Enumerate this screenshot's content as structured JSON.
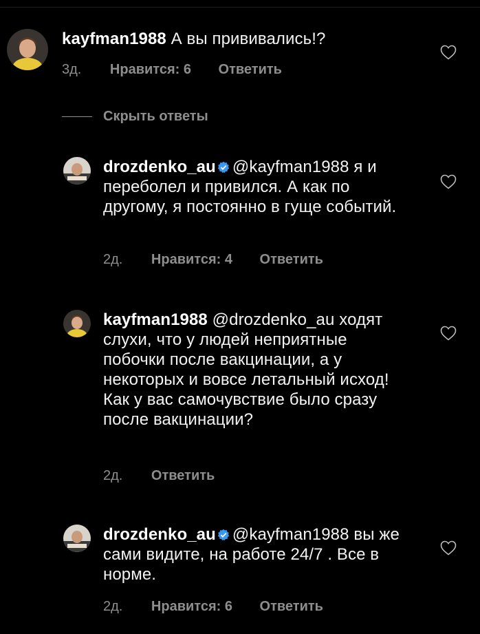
{
  "comments": [
    {
      "username": "kayfman1988",
      "verified": false,
      "mention": "",
      "text": "А вы прививались!?",
      "time": "3д.",
      "likes": "Нравится: 6",
      "reply": "Ответить",
      "avatar": "woman-avatar"
    },
    {
      "username": "drozdenko_au",
      "verified": true,
      "mention": "@kayfman1988",
      "text": "я и переболел и привился. А как по другому, я постоянно в гуще событий.",
      "time": "2д.",
      "likes": "Нравится: 4",
      "reply": "Ответить",
      "avatar": "man-avatar"
    },
    {
      "username": "kayfman1988",
      "verified": false,
      "mention": "@drozdenko_au",
      "text": "ходят слухи, что у людей неприятные побочки после вакцинации, а у некоторых и вовсе летальный исход! Как у вас самочувствие было сразу после вакцинации?",
      "time": "2д.",
      "likes": "",
      "reply": "Ответить",
      "avatar": "woman-avatar"
    },
    {
      "username": "drozdenko_au",
      "verified": true,
      "mention": "@kayfman1988",
      "text": "вы же сами видите, на работе 24/7 . Все в норме.",
      "time": "2д.",
      "likes": "Нравится: 6",
      "reply": "Ответить",
      "avatar": "man-avatar"
    }
  ],
  "hide_replies": "Скрыть ответы",
  "colors": {
    "background": "#000000",
    "text": "#ffffff",
    "secondary": "#8e8e8e",
    "verified": "#3897f0"
  }
}
